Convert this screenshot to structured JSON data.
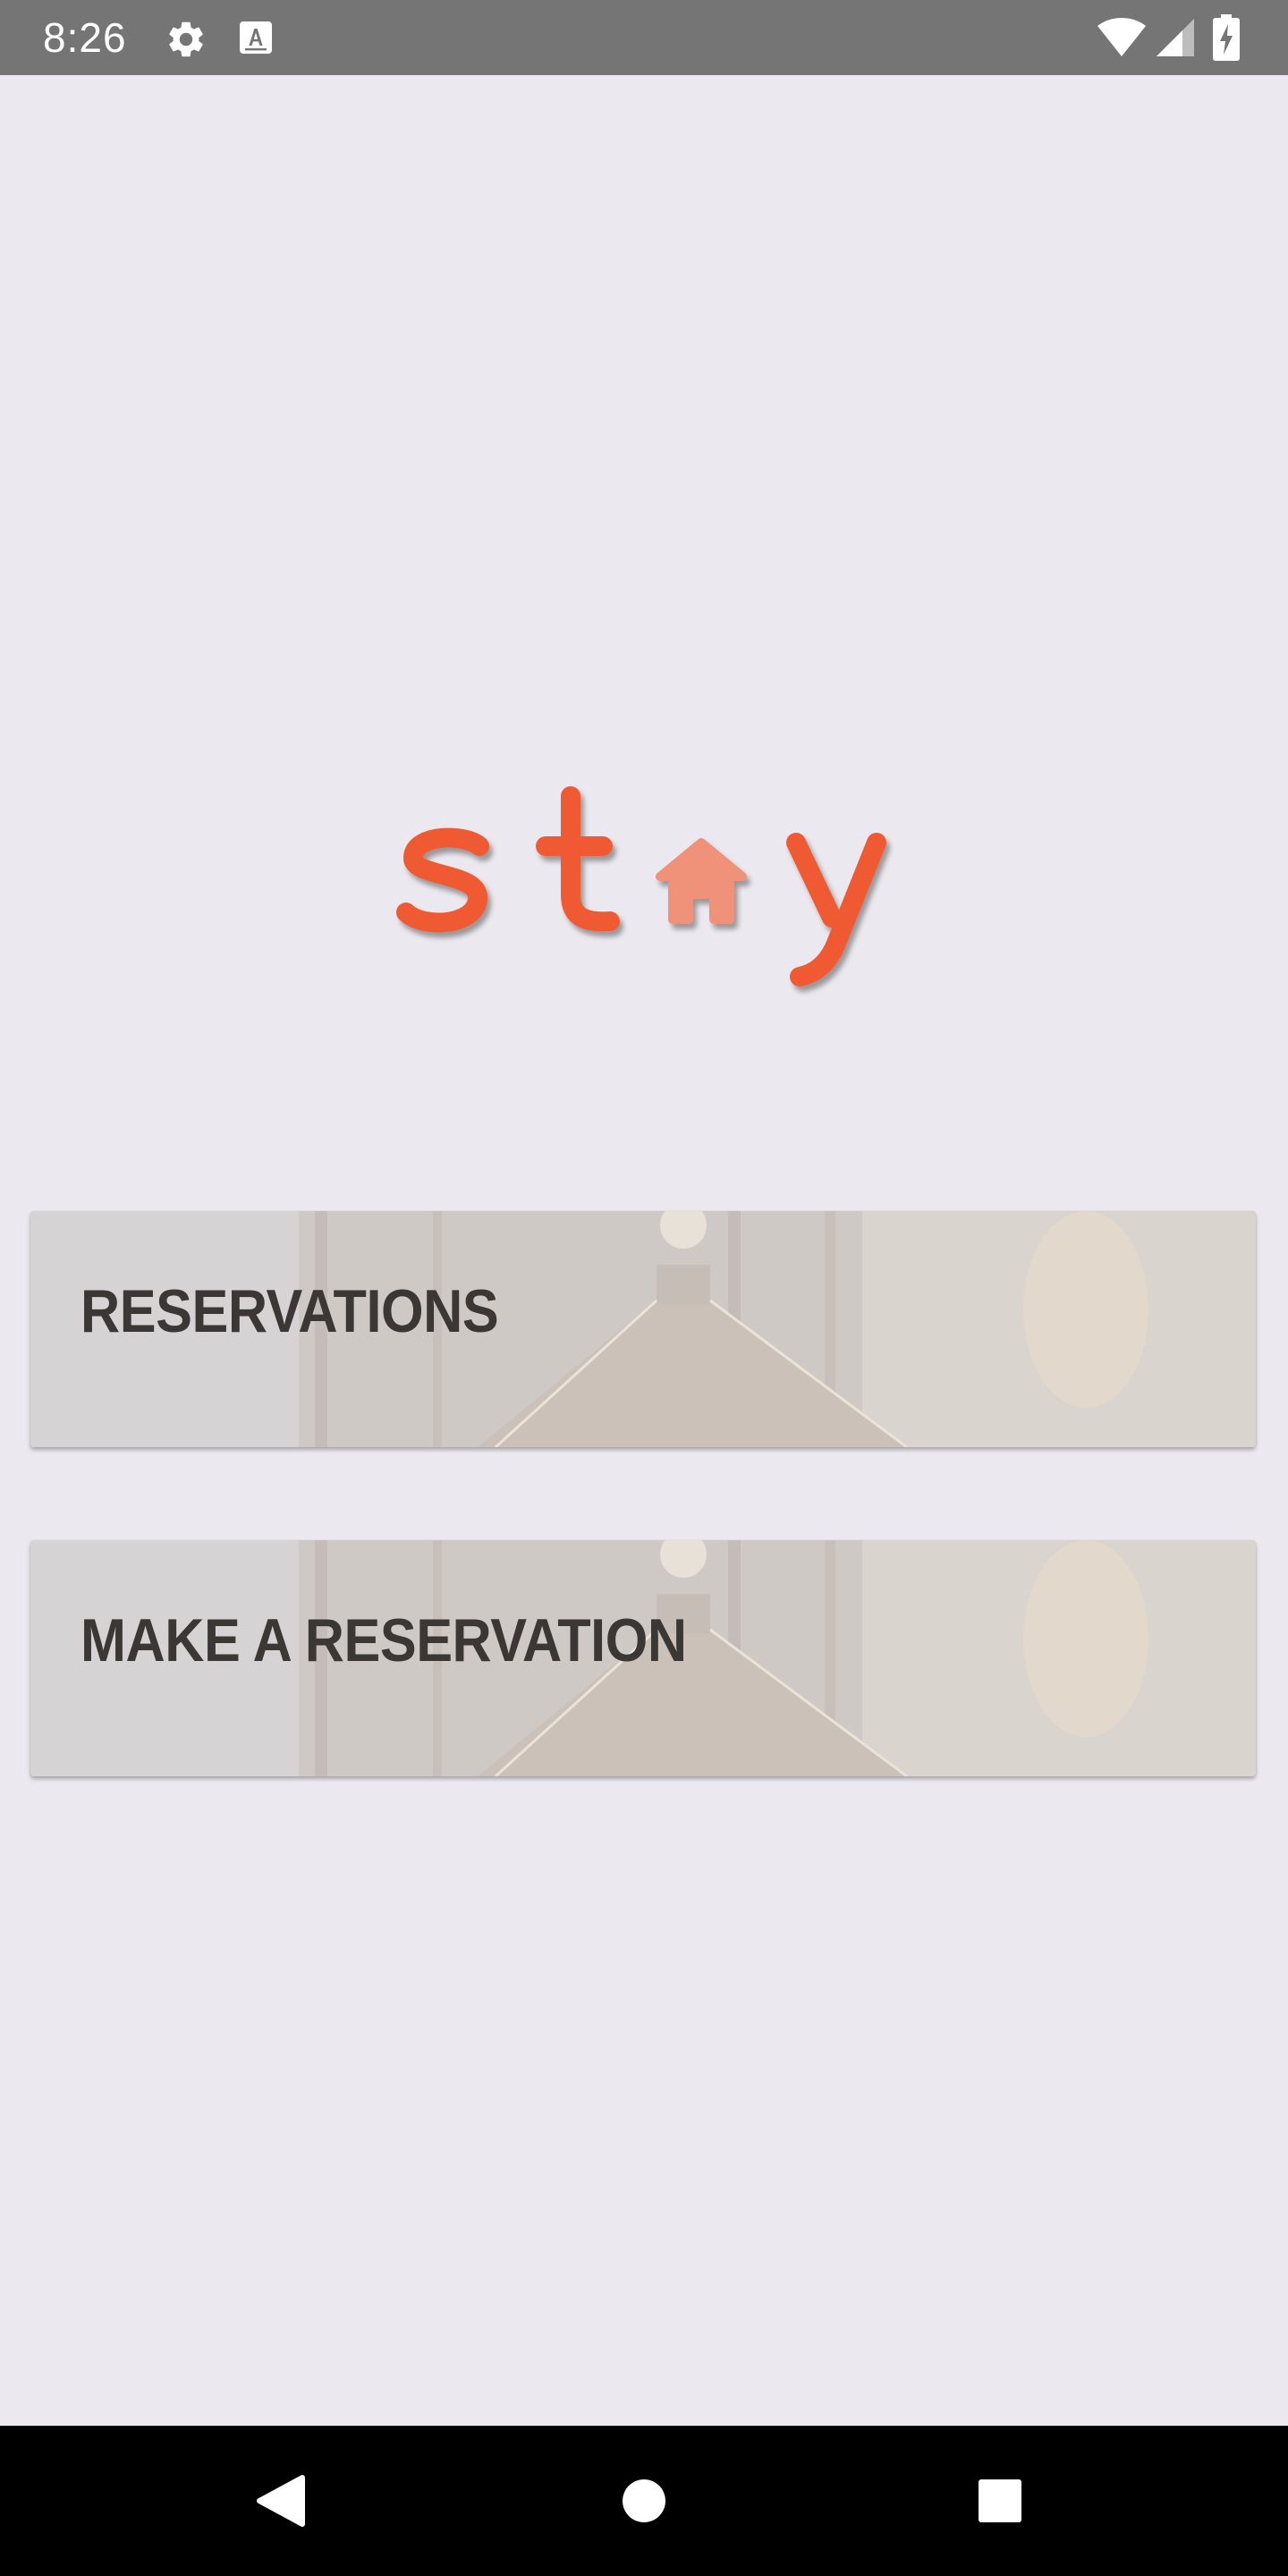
{
  "status_bar": {
    "time": "8:26",
    "left_icons": [
      "gear-icon",
      "keyboard-icon"
    ],
    "right_icons": [
      "wifi-icon",
      "signal-icon",
      "battery-charging-icon"
    ],
    "background": "#757575"
  },
  "logo": {
    "letters": [
      "s",
      "t",
      "y"
    ],
    "house_icon": "house-icon",
    "brand_color": "#f05a32",
    "house_color": "#f0917a"
  },
  "menu": {
    "items": [
      {
        "label": "RESERVATIONS",
        "background_image": "hotel-hallway"
      },
      {
        "label": "MAKE A RESERVATION",
        "background_image": "hotel-hallway"
      }
    ]
  },
  "nav_bar": {
    "buttons": [
      "back-triangle-icon",
      "home-circle-icon",
      "recents-square-icon"
    ]
  },
  "colors": {
    "page_background": "#ebe9ef",
    "card_text": "#3b3735"
  }
}
